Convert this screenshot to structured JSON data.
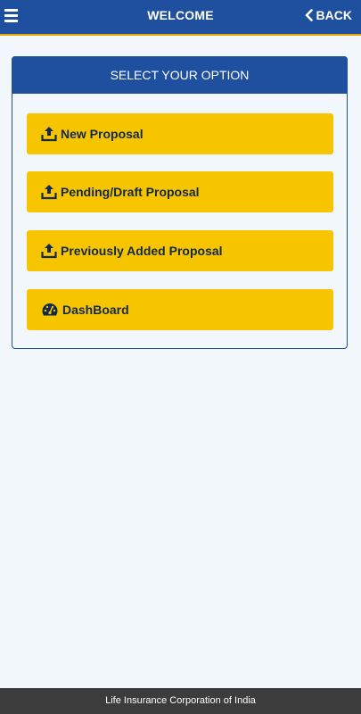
{
  "header": {
    "title": "WELCOME",
    "back_label": "BACK"
  },
  "panel": {
    "title": "SELECT YOUR OPTION",
    "options": [
      {
        "label": "New Proposal",
        "icon": "upload-icon"
      },
      {
        "label": "Pending/Draft Proposal",
        "icon": "upload-icon"
      },
      {
        "label": "Previously Added Proposal",
        "icon": "upload-icon"
      },
      {
        "label": "DashBoard",
        "icon": "dashboard-icon"
      }
    ]
  },
  "footer": {
    "text": "Life Insurance Corporation of India"
  },
  "colors": {
    "primary": "#1f4f9f",
    "accent": "#f7c400",
    "background": "#f2f7fc",
    "footer": "#3c3c3c"
  }
}
